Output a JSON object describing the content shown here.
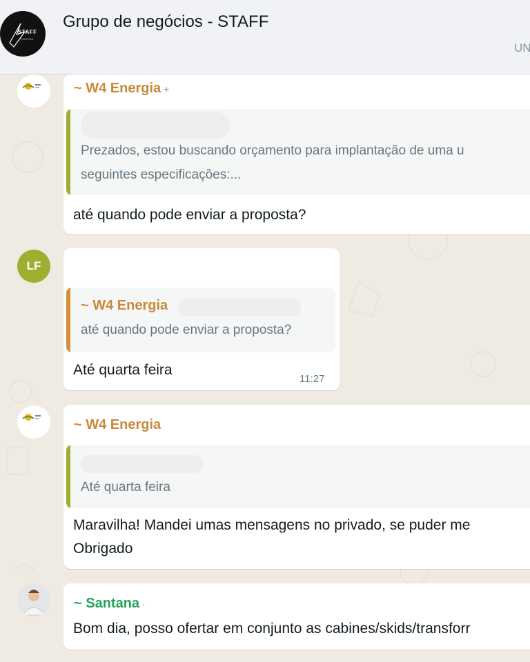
{
  "header": {
    "title": "Grupo de negócios - STAFF",
    "subtitle": "UN",
    "avatar_text": "STAFF",
    "avatar_subtext": "ENERGIA"
  },
  "messages": [
    {
      "sender": "~ W4 Energia",
      "sender_extra": "+",
      "quote_lines": [
        "Prezados, estou buscando orçamento para implantação de uma u",
        "seguintes especificações:..."
      ],
      "text": "até quando pode enviar a proposta?"
    },
    {
      "avatar_initials": "LF",
      "quote_author": "~ W4 Energia",
      "quote_text": "até quando pode enviar a proposta?",
      "text": "Até quarta feira",
      "time": "11:27"
    },
    {
      "sender": "~ W4 Energia",
      "quote_text": "Até quarta feira",
      "text_lines": [
        "Maravilha! Mandei umas mensagens no privado, se puder me",
        "Obrigado"
      ]
    },
    {
      "sender": "~ Santana",
      "sender_extra": "·",
      "text": "Bom dia, posso ofertar em conjunto as cabines/skids/transforr"
    }
  ],
  "colors": {
    "chat_bg": "#efeae2",
    "header_bg": "#f0f2f5",
    "w4_sender": "#c88a3a",
    "santana_sender": "#25a35a",
    "lf_avatar": "#9fae2e"
  }
}
